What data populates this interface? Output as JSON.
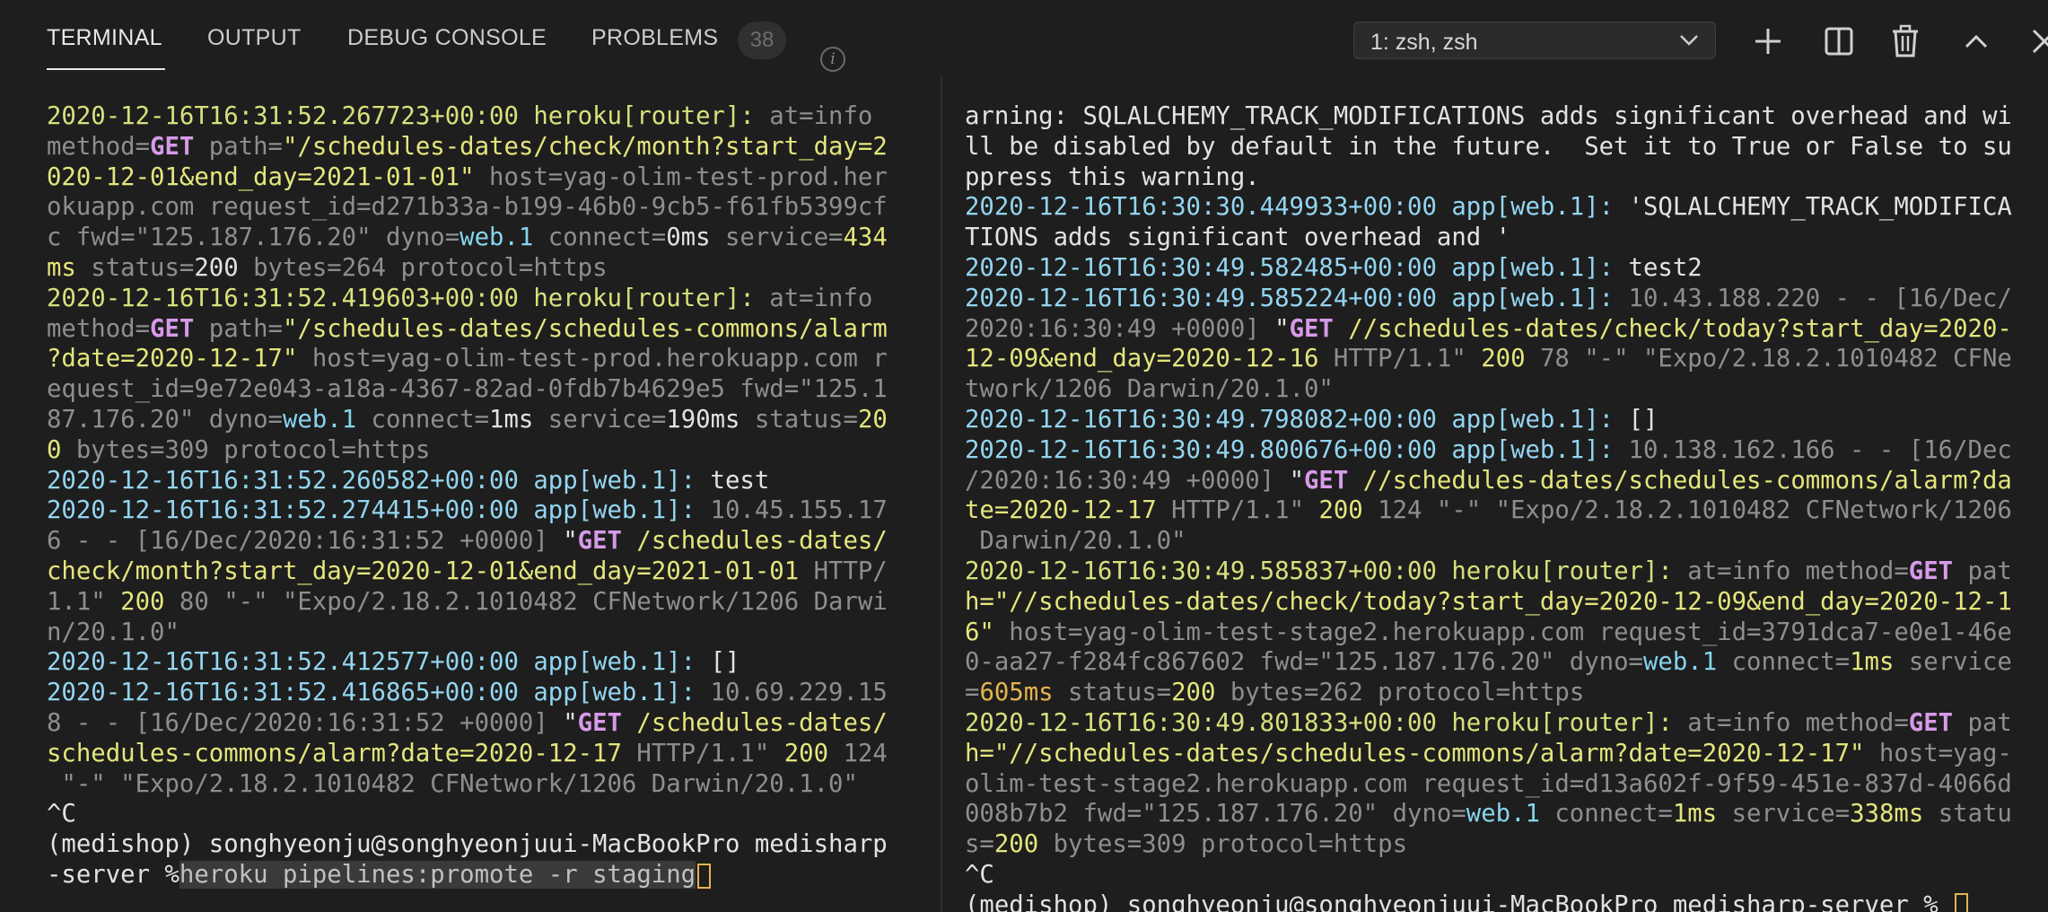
{
  "tabs": {
    "terminal": "TERMINAL",
    "output": "OUTPUT",
    "debug_console": "DEBUG CONSOLE",
    "problems": "PROBLEMS",
    "problems_count": "38"
  },
  "terminal_selector": {
    "value": "1: zsh, zsh"
  },
  "toolbar_icons": [
    "plus-icon",
    "split-icon",
    "trash-icon",
    "chevron-up-icon",
    "close-icon"
  ],
  "colors": {
    "background": "#1e1e1e",
    "timestamp": "#93d5f0",
    "router": "#d8e07c",
    "http_method": "#d79ae9",
    "highlight": "#e6b450"
  },
  "left_pane": [
    [
      [
        "tsy",
        "2020-12-16T16:31:52.267723+00:00 "
      ],
      [
        "srcy",
        "heroku[router]:"
      ],
      [
        "g",
        " at=info"
      ]
    ],
    [
      [
        "g",
        "method="
      ],
      [
        "m",
        "GET"
      ],
      [
        "g",
        " path="
      ],
      [
        "y",
        "\"/schedules-dates/check/month?start_day=2"
      ]
    ],
    [
      [
        "y",
        "020-12-01&end_day=2021-01-01\""
      ],
      [
        "g",
        " host=yag-olim-test-prod.her"
      ]
    ],
    [
      [
        "g",
        "okuapp.com request_id=d271b33a-b199-46b0-9cb5-f61fb5399cf"
      ]
    ],
    [
      [
        "g",
        "c fwd=\"125.187.176.20\" dyno="
      ],
      [
        "c",
        "web.1"
      ],
      [
        "g",
        " connect="
      ],
      [
        "w",
        "0ms"
      ],
      [
        "g",
        " service="
      ],
      [
        "y",
        "434"
      ]
    ],
    [
      [
        "y",
        "ms"
      ],
      [
        "g",
        " status="
      ],
      [
        "w",
        "200"
      ],
      [
        "g",
        " bytes=264 protocol=https"
      ]
    ],
    [
      [
        "tsy",
        "2020-12-16T16:31:52.419603+00:00 "
      ],
      [
        "srcy",
        "heroku[router]:"
      ],
      [
        "g",
        " at=info"
      ]
    ],
    [
      [
        "g",
        "method="
      ],
      [
        "m",
        "GET"
      ],
      [
        "g",
        " path="
      ],
      [
        "y",
        "\"/schedules-dates/schedules-commons/alarm"
      ]
    ],
    [
      [
        "y",
        "?date=2020-12-17\""
      ],
      [
        "g",
        " host=yag-olim-test-prod.herokuapp.com r"
      ]
    ],
    [
      [
        "g",
        "equest_id=9e72e043-a18a-4367-82ad-0fdb7b4629e5 fwd=\"125.1"
      ]
    ],
    [
      [
        "g",
        "87.176.20\" dyno="
      ],
      [
        "c",
        "web.1"
      ],
      [
        "g",
        " connect="
      ],
      [
        "w",
        "1ms"
      ],
      [
        "g",
        " service="
      ],
      [
        "w",
        "190ms"
      ],
      [
        "g",
        " status="
      ],
      [
        "y",
        "20"
      ]
    ],
    [
      [
        "y",
        "0"
      ],
      [
        "g",
        " bytes=309 protocol=https"
      ]
    ],
    [
      [
        "ts",
        "2020-12-16T16:31:52.260582+00:00 "
      ],
      [
        "src",
        "app[web.1]:"
      ],
      [
        "w",
        " test"
      ]
    ],
    [
      [
        "ts",
        "2020-12-16T16:31:52.274415+00:00 "
      ],
      [
        "src",
        "app[web.1]:"
      ],
      [
        "g",
        " 10.45.155.17"
      ]
    ],
    [
      [
        "g",
        "6 - - [16/Dec/2020:16:31:52 +0000] "
      ],
      [
        "w",
        "\""
      ],
      [
        "m",
        "GET"
      ],
      [
        "y",
        " /schedules-dates/"
      ]
    ],
    [
      [
        "y",
        "check/month?start_day=2020-12-01&end_day=2021-01-01"
      ],
      [
        "g",
        " HTTP/"
      ]
    ],
    [
      [
        "g",
        "1.1\" "
      ],
      [
        "y",
        "200"
      ],
      [
        "g",
        " 80 \"-\" \"Expo/2.18.2.1010482 CFNetwork/1206 Darwi"
      ]
    ],
    [
      [
        "g",
        "n/20.1.0\""
      ]
    ],
    [
      [
        "ts",
        "2020-12-16T16:31:52.412577+00:00 "
      ],
      [
        "src",
        "app[web.1]:"
      ],
      [
        "w",
        " []"
      ]
    ],
    [
      [
        "ts",
        "2020-12-16T16:31:52.416865+00:00 "
      ],
      [
        "src",
        "app[web.1]:"
      ],
      [
        "g",
        " 10.69.229.15"
      ]
    ],
    [
      [
        "g",
        "8 - - [16/Dec/2020:16:31:52 +0000] "
      ],
      [
        "w",
        "\""
      ],
      [
        "m",
        "GET"
      ],
      [
        "y",
        " /schedules-dates/"
      ]
    ],
    [
      [
        "y",
        "schedules-commons/alarm?date=2020-12-17"
      ],
      [
        "g",
        " HTTP/1.1\" "
      ],
      [
        "y",
        "200"
      ],
      [
        "g",
        " 124"
      ]
    ],
    [
      [
        "g",
        " \"-\" \"Expo/2.18.2.1010482 CFNetwork/1206 Darwin/20.1.0\""
      ]
    ],
    [
      [
        "w",
        "^C"
      ]
    ],
    [
      [
        "w",
        "(medishop) songhyeonju@songhyeonjuui-MacBookPro medisharp"
      ]
    ],
    [
      [
        "w",
        "-server %"
      ],
      [
        "sel",
        "heroku pipelines:promote -r staging"
      ]
    ]
  ],
  "right_pane": [
    [
      [
        "w",
        "arning: SQLALCHEMY_TRACK_MODIFICATIONS adds significant overhead and wi"
      ]
    ],
    [
      [
        "w",
        "ll be disabled by default in the future.  Set it to True or False to su"
      ]
    ],
    [
      [
        "w",
        "ppress this warning."
      ]
    ],
    [
      [
        "ts",
        "2020-12-16T16:30:30.449933+00:00 "
      ],
      [
        "src",
        "app[web.1]:"
      ],
      [
        "w",
        " 'SQLALCHEMY_TRACK_MODIFICA"
      ]
    ],
    [
      [
        "w",
        "TIONS adds significant overhead and '"
      ]
    ],
    [
      [
        "ts",
        "2020-12-16T16:30:49.582485+00:00 "
      ],
      [
        "src",
        "app[web.1]:"
      ],
      [
        "w",
        " test2"
      ]
    ],
    [
      [
        "ts",
        "2020-12-16T16:30:49.585224+00:00 "
      ],
      [
        "src",
        "app[web.1]:"
      ],
      [
        "g",
        " 10.43.188.220 - - [16/Dec/"
      ]
    ],
    [
      [
        "g",
        "2020:16:30:49 +0000] "
      ],
      [
        "w",
        "\""
      ],
      [
        "m",
        "GET"
      ],
      [
        "y",
        " //schedules-dates/check/today?start_day=2020-"
      ]
    ],
    [
      [
        "y",
        "12-09&end_day=2020-12-16"
      ],
      [
        "g",
        " HTTP/1.1\" "
      ],
      [
        "y",
        "200"
      ],
      [
        "g",
        " 78 \"-\" \"Expo/2.18.2.1010482 CFNe"
      ]
    ],
    [
      [
        "g",
        "twork/1206 Darwin/20.1.0\""
      ]
    ],
    [
      [
        "ts",
        "2020-12-16T16:30:49.798082+00:00 "
      ],
      [
        "src",
        "app[web.1]:"
      ],
      [
        "w",
        " []"
      ]
    ],
    [
      [
        "ts",
        "2020-12-16T16:30:49.800676+00:00 "
      ],
      [
        "src",
        "app[web.1]:"
      ],
      [
        "g",
        " 10.138.162.166 - - [16/Dec"
      ]
    ],
    [
      [
        "g",
        "/2020:16:30:49 +0000] "
      ],
      [
        "w",
        "\""
      ],
      [
        "m",
        "GET"
      ],
      [
        "y",
        " //schedules-dates/schedules-commons/alarm?da"
      ]
    ],
    [
      [
        "y",
        "te=2020-12-17"
      ],
      [
        "g",
        " HTTP/1.1\" "
      ],
      [
        "y",
        "200"
      ],
      [
        "g",
        " 124 \"-\" \"Expo/2.18.2.1010482 CFNetwork/1206"
      ]
    ],
    [
      [
        "g",
        " Darwin/20.1.0\""
      ]
    ],
    [
      [
        "tsy",
        "2020-12-16T16:30:49.585837+00:00 "
      ],
      [
        "srcy",
        "heroku[router]:"
      ],
      [
        "g",
        " at=info method="
      ],
      [
        "m",
        "GET"
      ],
      [
        "g",
        " pat"
      ]
    ],
    [
      [
        "y",
        "h=\"//schedules-dates/check/today?start_day=2020-12-09&end_day=2020-12-1"
      ]
    ],
    [
      [
        "y",
        "6\""
      ],
      [
        "g",
        " host=yag-olim-test-stage2.herokuapp.com request_id=3791dca7-e0e1-46e"
      ]
    ],
    [
      [
        "g",
        "0-aa27-f284fc867602 fwd=\"125.187.176.20\" dyno="
      ],
      [
        "c",
        "web.1"
      ],
      [
        "g",
        " connect="
      ],
      [
        "y",
        "1ms"
      ],
      [
        "g",
        " service"
      ]
    ],
    [
      [
        "g",
        "="
      ],
      [
        "o",
        "605ms"
      ],
      [
        "g",
        " status="
      ],
      [
        "y",
        "200"
      ],
      [
        "g",
        " bytes=262 protocol=https"
      ]
    ],
    [
      [
        "tsy",
        "2020-12-16T16:30:49.801833+00:00 "
      ],
      [
        "srcy",
        "heroku[router]:"
      ],
      [
        "g",
        " at=info method="
      ],
      [
        "m",
        "GET"
      ],
      [
        "g",
        " pat"
      ]
    ],
    [
      [
        "y",
        "h=\"//schedules-dates/schedules-commons/alarm?date=2020-12-17\""
      ],
      [
        "g",
        " host=yag-"
      ]
    ],
    [
      [
        "g",
        "olim-test-stage2.herokuapp.com request_id=d13a602f-9f59-451e-837d-4066d"
      ]
    ],
    [
      [
        "g",
        "008b7b2 fwd=\"125.187.176.20\" dyno="
      ],
      [
        "c",
        "web.1"
      ],
      [
        "g",
        " connect="
      ],
      [
        "y",
        "1ms"
      ],
      [
        "g",
        " service="
      ],
      [
        "y",
        "338ms"
      ],
      [
        "g",
        " statu"
      ]
    ],
    [
      [
        "g",
        "s="
      ],
      [
        "y",
        "200"
      ],
      [
        "g",
        " bytes=309 protocol=https"
      ]
    ],
    [
      [
        "w",
        "^C"
      ]
    ],
    [
      [
        "w",
        "(medishop) songhyeonju@songhyeonjuui-MacBookPro medisharp-server % "
      ]
    ]
  ]
}
